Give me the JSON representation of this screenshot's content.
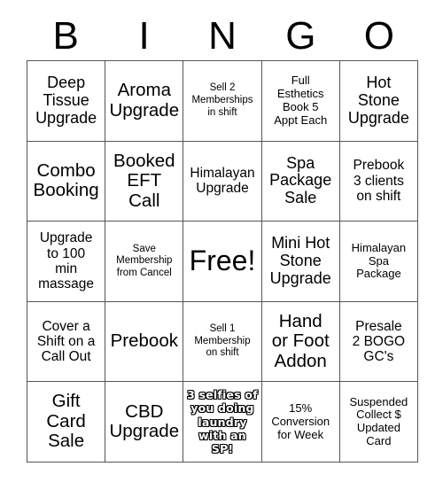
{
  "card": {
    "title": "BINGO",
    "header_letters": [
      "B",
      "I",
      "N",
      "G",
      "O"
    ],
    "free_space_label": "Free!",
    "border_color": "#555555",
    "text_color": "#000000",
    "background_color": "#ffffff"
  },
  "cells": {
    "r0c0": "Deep\nTissue\nUpgrade",
    "r0c1": "Aroma\nUpgrade",
    "r0c2": "Sell 2\nMemberships\nin shift",
    "r0c3": "Full\nEsthetics\nBook 5\nAppt Each",
    "r0c4": "Hot\nStone\nUpgrade",
    "r1c0": "Combo\nBooking",
    "r1c1": "Booked\nEFT\nCall",
    "r1c2": "Himalayan\nUpgrade",
    "r1c3": "Spa\nPackage\nSale",
    "r1c4": "Prebook\n3 clients\non shift",
    "r2c0": "Upgrade\nto 100\nmin\nmassage",
    "r2c1": "Save\nMembership\nfrom Cancel",
    "r2c2": "Free!",
    "r2c3": "Mini Hot\nStone\nUpgrade",
    "r2c4": "Himalayan\nSpa\nPackage",
    "r3c0": "Cover a\nShift on a\nCall Out",
    "r3c1": "Prebook",
    "r3c2": "Sell 1\nMembership\non shift",
    "r3c3": "Hand\nor Foot\nAddon",
    "r3c4": "Presale\n2 BOGO\nGC's",
    "r4c0": "Gift\nCard\nSale",
    "r4c1": "CBD\nUpgrade",
    "r4c2": "3 selfies of\nyou doing\nlaundry\nwith an SP!",
    "r4c3": "15%\nConversion\nfor Week",
    "r4c4": "Suspended\nCollect $\nUpdated\nCard"
  }
}
